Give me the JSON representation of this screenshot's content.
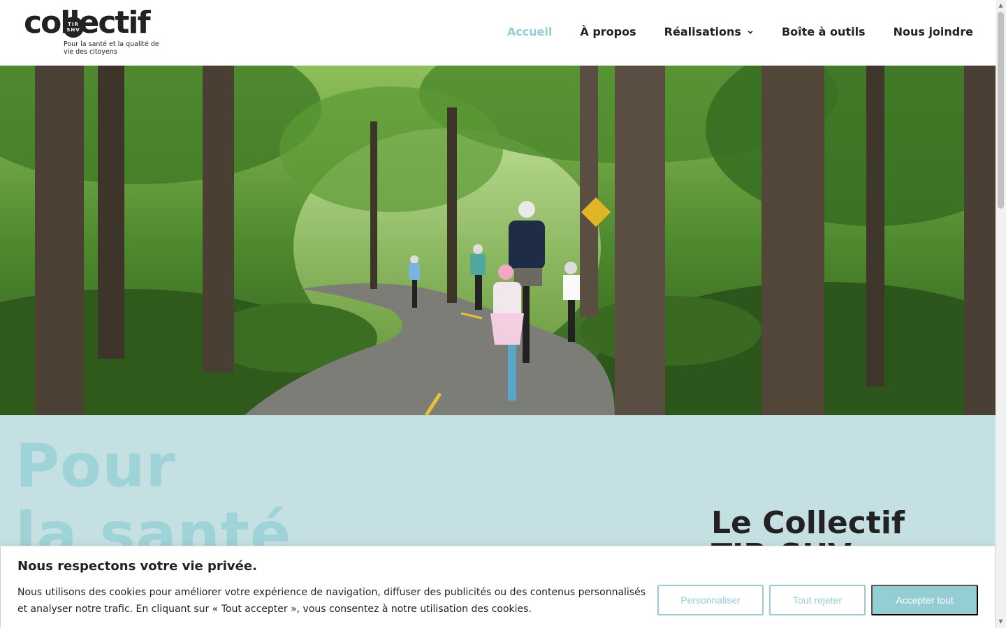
{
  "header": {
    "logo_word": "collectif",
    "logo_badge": "TIR SHV",
    "logo_tagline": "Pour la santé et la qualité de vie des citoyens",
    "nav": [
      {
        "label": "Accueil",
        "active": true
      },
      {
        "label": "À propos",
        "active": false
      },
      {
        "label": "Réalisations",
        "active": false,
        "has_dropdown": true
      },
      {
        "label": "Boîte à outils",
        "active": false
      },
      {
        "label": "Nous joindre",
        "active": false
      }
    ]
  },
  "hero": {
    "image": "family cycling on a paved forest trail"
  },
  "intro": {
    "slogan_line1": "Pour",
    "slogan_line2": "la santé",
    "title_line1": "Le Collectif",
    "title_line2": "TIR-SHV"
  },
  "cookie_banner": {
    "title": "Nous respectons votre vie privée.",
    "text": "Nous utilisons des cookies pour améliorer votre expérience de navigation, diffuser des publicités ou des contenus personnalisés et analyser notre trafic. En cliquant sur « Tout accepter », vous consentez à notre utilisation des cookies.",
    "customize_label": "Personnaliser",
    "reject_label": "Tout rejeter",
    "accept_label": "Accepter tout"
  },
  "colors": {
    "accent": "#94cdd3",
    "section_bg": "#c5e0e3",
    "slogan": "#9ed3d8",
    "text": "#222222"
  }
}
